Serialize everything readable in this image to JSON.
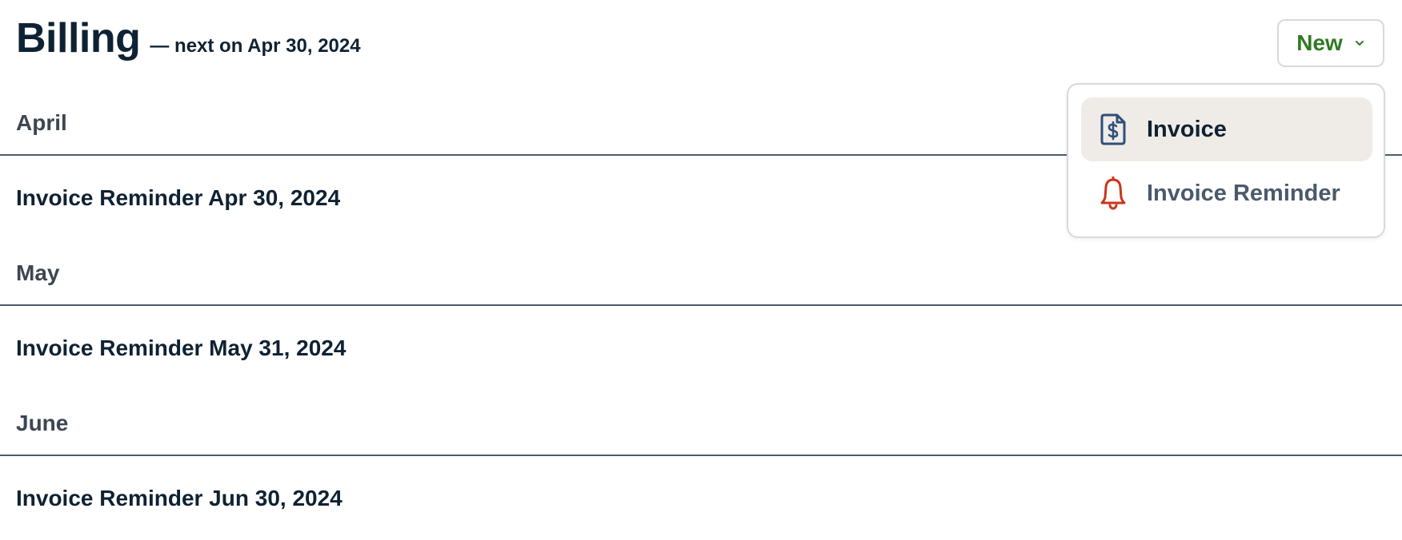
{
  "header": {
    "title": "Billing",
    "subtitle": "— next on Apr 30, 2024"
  },
  "toolbar": {
    "new_label": "New",
    "new_icon": "chevron-down-icon",
    "accent_color": "#2f7a22"
  },
  "sections": [
    {
      "month": "April",
      "items": [
        "Invoice Reminder Apr 30, 2024"
      ]
    },
    {
      "month": "May",
      "items": [
        "Invoice Reminder May 31, 2024"
      ]
    },
    {
      "month": "June",
      "items": [
        "Invoice Reminder Jun 30, 2024"
      ]
    }
  ],
  "dropdown": {
    "items": [
      {
        "label": "Invoice",
        "icon": "invoice-dollar-icon",
        "icon_color": "#2f4f7a",
        "active": true
      },
      {
        "label": "Invoice Reminder",
        "icon": "bell-icon",
        "icon_color": "#c8361e",
        "active": false
      }
    ]
  }
}
